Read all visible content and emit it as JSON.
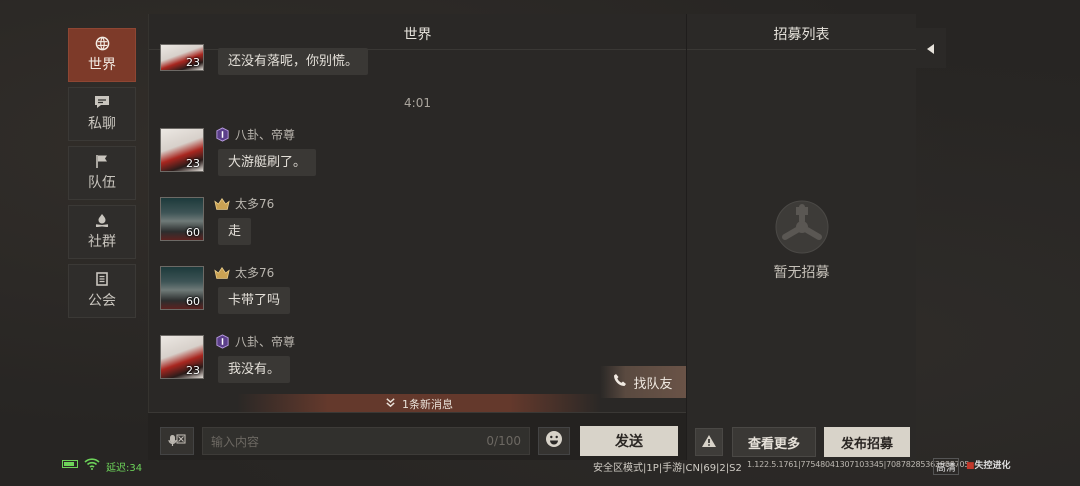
{
  "nav": {
    "items": [
      {
        "label": "世界",
        "icon": "globe-icon",
        "active": true
      },
      {
        "label": "私聊",
        "icon": "chat-bubble-icon",
        "active": false
      },
      {
        "label": "队伍",
        "icon": "flag-icon",
        "active": false
      },
      {
        "label": "社群",
        "icon": "campfire-icon",
        "active": false
      },
      {
        "label": "公会",
        "icon": "guild-banner-icon",
        "active": false
      }
    ]
  },
  "chat": {
    "title": "世界",
    "time_divider": "4:01",
    "messages": [
      {
        "name": "",
        "level": "23",
        "text": "还没有落呢，你别慌。"
      },
      {
        "name": "八卦、帝尊",
        "level": "23",
        "badge": "purple-rank-badge",
        "text": "大游艇刷了。"
      },
      {
        "name": "太多76",
        "level": "60",
        "badge": "gold-crown-badge",
        "text": "走"
      },
      {
        "name": "太多76",
        "level": "60",
        "badge": "gold-crown-badge",
        "text": "卡带了吗"
      },
      {
        "name": "八卦、帝尊",
        "level": "23",
        "badge": "purple-rank-badge",
        "text": "我没有。"
      }
    ],
    "find_team_label": "找队友",
    "new_messages_label": "1条新消息",
    "input_placeholder": "输入内容",
    "input_counter": "0/100",
    "send_label": "发送"
  },
  "recruit": {
    "title": "招募列表",
    "empty_text": "暂无招募",
    "more_label": "查看更多",
    "publish_label": "发布招募"
  },
  "status_bar": {
    "ping": "延迟:34",
    "server_info": "安全区模式|1P|手游|CN|69|2|S2",
    "build": "1.122.5.1761|77548041307103345|70878285362888705",
    "quality": "高清",
    "logo": "失控进化"
  },
  "colors": {
    "accent": "#7d3a29",
    "primary_button": "#d8d3c9",
    "ping_green": "#6dd35a"
  }
}
